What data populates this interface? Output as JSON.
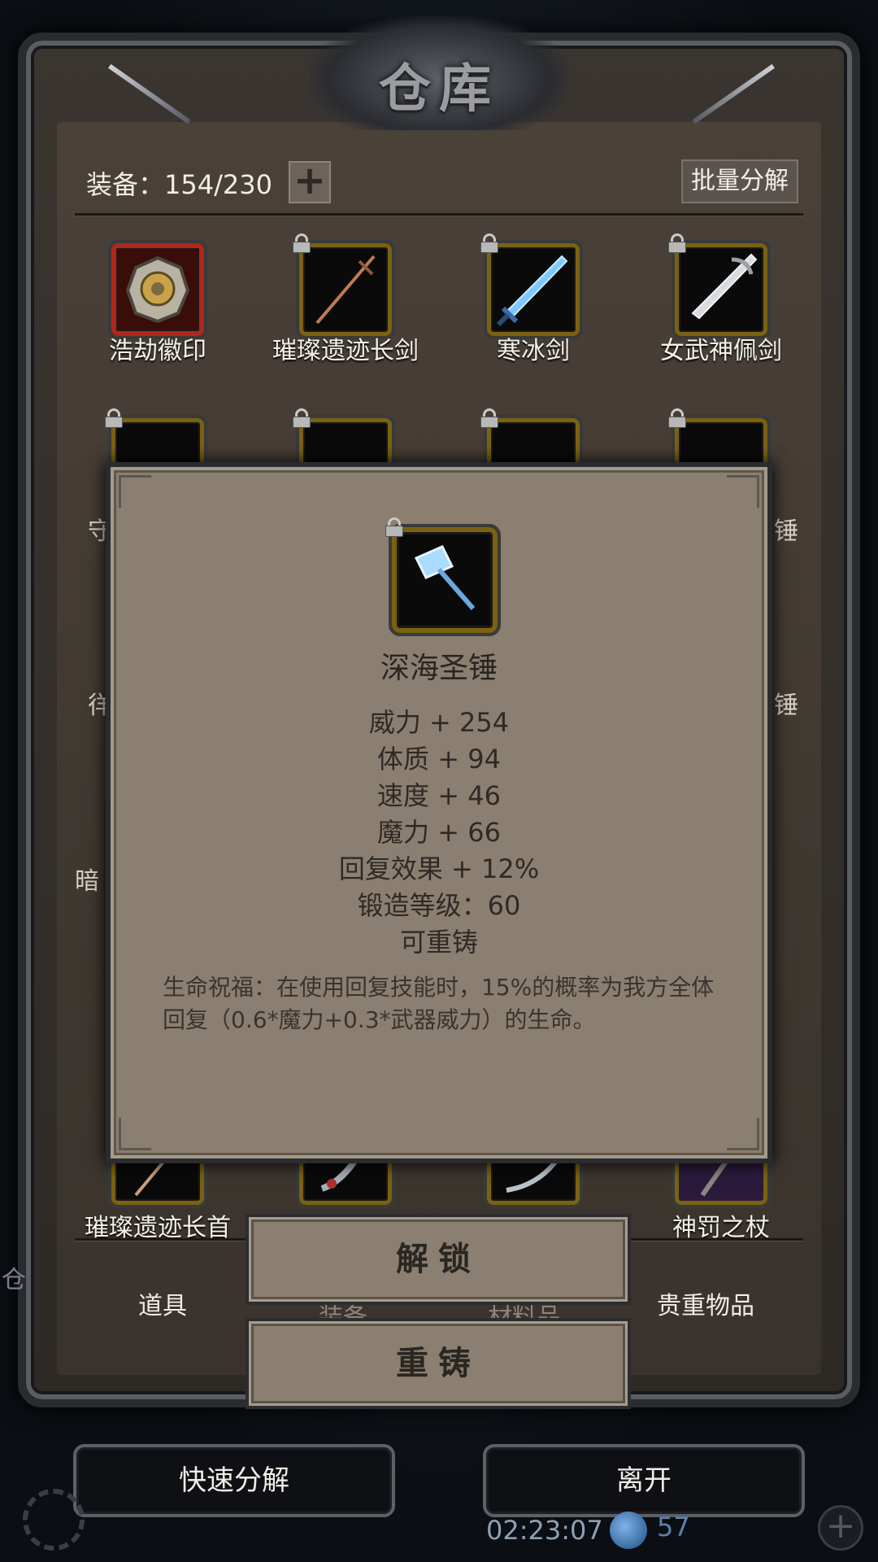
{
  "header": {
    "title": "仓库"
  },
  "toolbar": {
    "equip_label": "装备：154/230",
    "add_symbol": "+",
    "batch_label": "批量分解"
  },
  "grid": {
    "row1": [
      {
        "name": "浩劫徽印",
        "icon": "emblem-icon",
        "locked": false,
        "rarity": "red"
      },
      {
        "name": "璀璨遗迹长剑",
        "icon": "longsword-icon",
        "locked": true,
        "rarity": "gold"
      },
      {
        "name": "寒冰剑",
        "icon": "ice-sword-icon",
        "locked": true,
        "rarity": "gold"
      },
      {
        "name": "女武神佩剑",
        "icon": "valkyrie-sword-icon",
        "locked": true,
        "rarity": "gold"
      }
    ],
    "partial_labels": {
      "row2_left": "守",
      "row2_right": "锤",
      "row3_left": "徉",
      "row3_right": "锤",
      "row4_left": "暗"
    },
    "bottom_row": [
      {
        "name": "璀璨遗迹长首",
        "icon": "dagger-icon"
      },
      {
        "name": "",
        "icon": "blade-icon"
      },
      {
        "name": "",
        "icon": "curved-blade-icon"
      },
      {
        "name": "神罚之杖",
        "icon": "staff-icon"
      }
    ]
  },
  "tabs": {
    "props": "道具",
    "equipment": "装备",
    "materials": "材料品",
    "valuables": "贵重物品",
    "side_char": "仓"
  },
  "popup": {
    "item_name": "深海圣锤",
    "icon": "hammer-icon",
    "stats": [
      "威力 + 254",
      "体质 + 94",
      "速度 + 46",
      "魔力 + 66",
      "回复效果 + 12%",
      "锻造等级：60",
      "可重铸"
    ],
    "description": "生命祝福：在使用回复技能时，15%的概率为我方全体回复（0.6*魔力+0.3*武器威力）的生命。"
  },
  "actions": {
    "unlock": "解锁",
    "reforge": "重铸"
  },
  "footer": {
    "quick_decompose": "快速分解",
    "leave": "离开",
    "time": "02:23:07",
    "gems": "57"
  }
}
